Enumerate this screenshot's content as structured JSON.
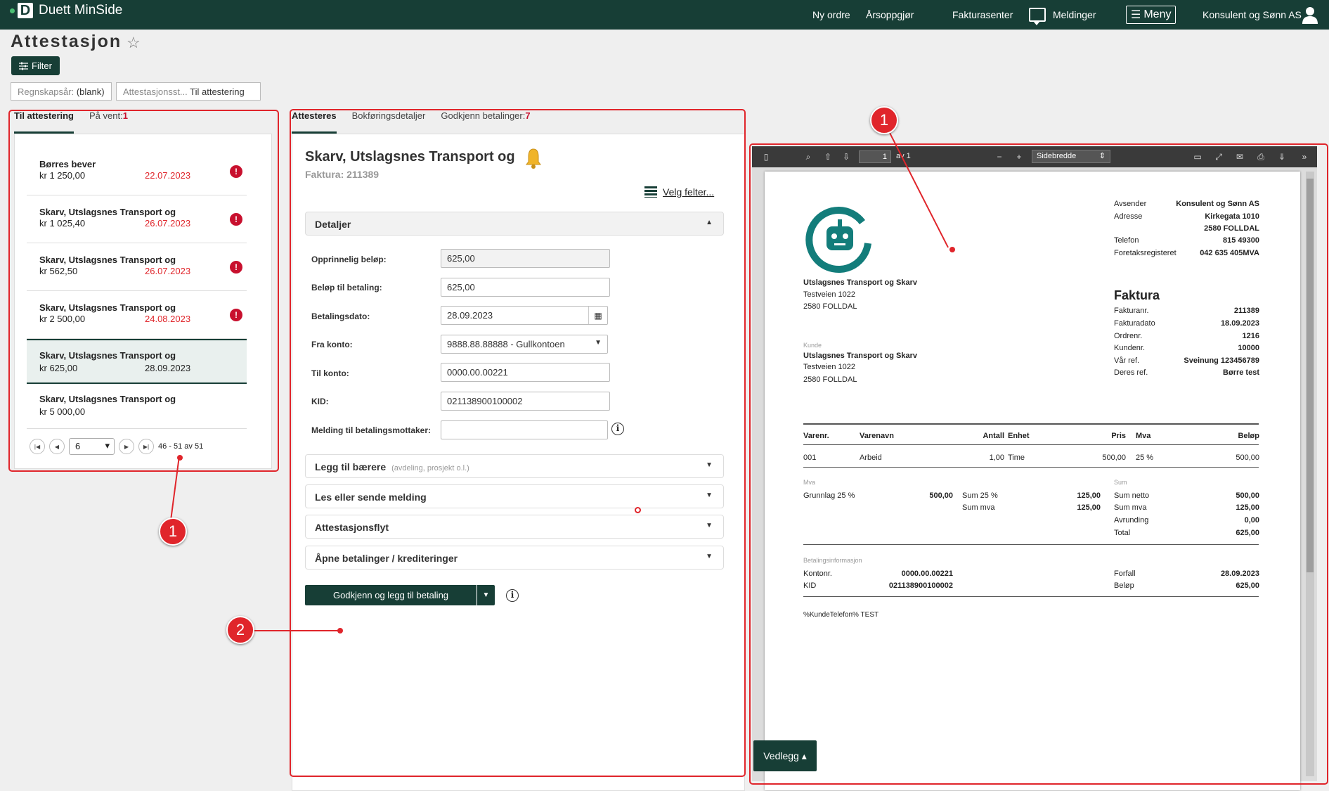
{
  "app": {
    "brand": "Duett MinSide"
  },
  "topnav": {
    "items": [
      "Ny ordre",
      "Årsoppgjør",
      "Fakturasenter"
    ],
    "messages": "Meldinger",
    "menu": "Meny",
    "company": "Konsulent og Sønn AS"
  },
  "page": {
    "title": "Attestasjon",
    "filter_label": "Filter"
  },
  "chips": [
    {
      "label": "Regnskapsår:",
      "value": "(blank)"
    },
    {
      "label": "Attestasjonsst...",
      "value": "Til attestering"
    }
  ],
  "left_tabs": [
    {
      "label": "Til attestering",
      "count": ""
    },
    {
      "label": "På vent:",
      "count": "1"
    }
  ],
  "invoices": [
    {
      "name": "Børres bever",
      "amount": "kr 1 250,00",
      "date": "22.07.2023"
    },
    {
      "name": "Skarv, Utslagsnes Transport og",
      "amount": "kr 1 025,40",
      "date": "26.07.2023"
    },
    {
      "name": "Skarv, Utslagsnes Transport og",
      "amount": "kr 562,50",
      "date": "26.07.2023"
    },
    {
      "name": "Skarv, Utslagsnes Transport og",
      "amount": "kr 2 500,00",
      "date": "24.08.2023"
    },
    {
      "name": "Skarv, Utslagsnes Transport og",
      "amount": "kr 625,00",
      "date": "28.09.2023"
    },
    {
      "name": "Skarv, Utslagsnes Transport og",
      "amount": "kr 5 000,00",
      "date": ""
    }
  ],
  "pager": {
    "page": "6",
    "range": "46 - 51 av 51"
  },
  "mid_tabs": [
    {
      "label": "Attesteres",
      "count": ""
    },
    {
      "label": "Bokføringsdetaljer",
      "count": ""
    },
    {
      "label": "Godkjenn betalinger:",
      "count": "7"
    }
  ],
  "detail": {
    "title": "Skarv, Utslagsnes Transport og",
    "subtitle": "Faktura: 211389",
    "velg": "Velg felter...",
    "section": "Detaljer",
    "fields": [
      {
        "label": "Opprinnelig beløp:",
        "value": "625,00"
      },
      {
        "label": "Beløp til betaling:",
        "value": "625,00"
      },
      {
        "label": "Betalingsdato:",
        "value": "28.09.2023"
      },
      {
        "label": "Fra konto:",
        "value": "9888.88.88888 - Gullkontoen"
      },
      {
        "label": "Til konto:",
        "value": "0000.00.00221"
      },
      {
        "label": "KID:",
        "value": "021138900100002"
      },
      {
        "label": "Melding til betalingsmottaker:",
        "value": ""
      }
    ],
    "sections": [
      {
        "label": "Legg til bærere",
        "sub": "(avdeling, prosjekt o.l.)"
      },
      {
        "label": "Les eller sende melding",
        "sub": ""
      },
      {
        "label": "Attestasjonsflyt",
        "sub": ""
      },
      {
        "label": "Åpne betalinger / krediteringer",
        "sub": ""
      }
    ],
    "approve": "Godkjenn og legg til betaling"
  },
  "viewer": {
    "page": "1",
    "of": "av 1",
    "zoom": "Sidebredde",
    "attachment": "Vedlegg"
  },
  "pdf": {
    "sender": [
      {
        "k": "Avsender",
        "v": "Konsulent og Sønn AS"
      },
      {
        "k": "Adresse",
        "v": "Kirkegata 1010"
      },
      {
        "k": "",
        "v": "2580 FOLLDAL"
      },
      {
        "k": "Telefon",
        "v": "815 49300"
      },
      {
        "k": "Foretaksregisteret",
        "v": "042 635 405MVA"
      }
    ],
    "recipient": [
      "Utslagsnes Transport og Skarv",
      "Testveien 1022",
      "2580 FOLLDAL"
    ],
    "kunde_label": "Kunde",
    "kunde": [
      "Utslagsnes Transport og Skarv",
      "Testveien 1022",
      "2580 FOLLDAL"
    ],
    "doc_title": "Faktura",
    "meta": [
      {
        "k": "Fakturanr.",
        "v": "211389"
      },
      {
        "k": "Fakturadato",
        "v": "18.09.2023"
      },
      {
        "k": "Ordrenr.",
        "v": "1216"
      },
      {
        "k": "Kundenr.",
        "v": "10000"
      },
      {
        "k": "Vår ref.",
        "v": "Sveinung 123456789"
      },
      {
        "k": "Deres ref.",
        "v": "Børre test"
      }
    ],
    "table_headers": [
      "Varenr.",
      "Varenavn",
      "Antall",
      "Enhet",
      "Pris",
      "Mva",
      "Beløp"
    ],
    "rows": [
      [
        "001",
        "Arbeid",
        "1,00",
        "Time",
        "500,00",
        "25 %",
        "500,00"
      ]
    ],
    "mva_label": "Mva",
    "mva": {
      "grunnlag": "Grunnlag 25 %",
      "grunnlag_v": "500,00",
      "s25": "Sum 25 %",
      "s25_v": "125,00",
      "smva": "Sum mva",
      "smva_v": "125,00"
    },
    "sum_label": "Sum",
    "sums": [
      {
        "k": "Sum netto",
        "v": "500,00"
      },
      {
        "k": "Sum mva",
        "v": "125,00"
      },
      {
        "k": "Avrunding",
        "v": "0,00"
      },
      {
        "k": "Total",
        "v": "625,00"
      }
    ],
    "pay_label": "Betalingsinformasjon",
    "pay": {
      "kontonr": "Kontonr.",
      "kontonr_v": "0000.00.00221",
      "kid": "KID",
      "kid_v": "021138900100002",
      "forfall": "Forfall",
      "forfall_v": "28.09.2023",
      "belop": "Beløp",
      "belop_v": "625,00"
    },
    "footer": "%KundeTelefon% TEST"
  },
  "callouts": [
    "1",
    "1",
    "2"
  ],
  "colors": {
    "brand": "#173e36",
    "alert": "#c8102e",
    "annotation": "#e0252b"
  }
}
